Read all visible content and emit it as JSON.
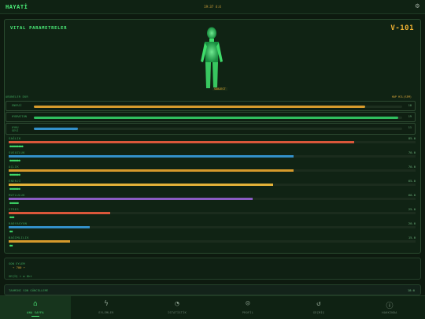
{
  "app": {
    "title": "HAYATİ",
    "clock": "19:37 4:4"
  },
  "panel": {
    "title": "VITAL PARAMETRELER",
    "vault_code": "V-101",
    "figure_label": "SUBJECT"
  },
  "status": {
    "left": "ABONELER DUR",
    "right": "HAP HIL(SEM)"
  },
  "meters": [
    {
      "label": "ENERJİ",
      "value": "18",
      "fill": 0.9,
      "color": "#d69a2c"
    },
    {
      "label": "HYDRATION",
      "value": "19",
      "fill": 0.99,
      "color": "#2fbf5e"
    },
    {
      "label": "UYKU\nSEVİ",
      "value": "11",
      "fill": 0.12,
      "color": "#3390c9"
    }
  ],
  "stats": [
    {
      "name": "SAĞLIK",
      "value": "85.0",
      "fill": 0.85,
      "color": "#d9573a",
      "pips": "●●●●●●●●●"
    },
    {
      "name": "SUSUZLUK",
      "value": "70.0",
      "fill": 0.7,
      "color": "#3390c9",
      "pips": "●●●●●●●"
    },
    {
      "name": "AÇLIK",
      "value": "70.0",
      "fill": 0.7,
      "color": "#d69a2c",
      "pips": "●●●●●●●"
    },
    {
      "name": "ENERJİ",
      "value": "65.0",
      "fill": 0.65,
      "color": "#e3b238",
      "pips": "●●●●●●●"
    },
    {
      "name": "MUTLULUK",
      "value": "60.0",
      "fill": 0.6,
      "color": "#8a5cc2",
      "pips": "●●●●●●"
    },
    {
      "name": "STRES",
      "value": "25.0",
      "fill": 0.25,
      "color": "#d9573a",
      "pips": "●●●"
    },
    {
      "name": "RADYASYON",
      "value": "20.0",
      "fill": 0.2,
      "color": "#3390c9",
      "pips": "●●"
    },
    {
      "name": "BAĞIMLILIK",
      "value": "15.0",
      "fill": 0.15,
      "color": "#d69a2c",
      "pips": "●●"
    }
  ],
  "info": {
    "line1": "SON EYLEM",
    "line2": "→ 700 ←",
    "line3": "GEÇİŞ ⬆ ✿ 8ht"
  },
  "alert": {
    "text": "TAHMINI SON GÜNCELLEME",
    "value": "18:0"
  },
  "nav": [
    {
      "label": "ANA SAYFA",
      "icon": "⌂",
      "icon_name": "home-icon",
      "active": true
    },
    {
      "label": "EYLEMLER",
      "icon": "ϟ",
      "icon_name": "bolt-icon",
      "active": false
    },
    {
      "label": "İSTATİSTİK",
      "icon": "◔",
      "icon_name": "pie-chart-icon",
      "active": false
    },
    {
      "label": "PROFİL",
      "icon": "☺",
      "icon_name": "person-icon",
      "active": false
    },
    {
      "label": "GEÇMİŞ",
      "icon": "↺",
      "icon_name": "history-icon",
      "active": false
    },
    {
      "label": "HAKKINDA",
      "icon": "ⓘ",
      "icon_name": "info-icon",
      "active": false
    }
  ]
}
